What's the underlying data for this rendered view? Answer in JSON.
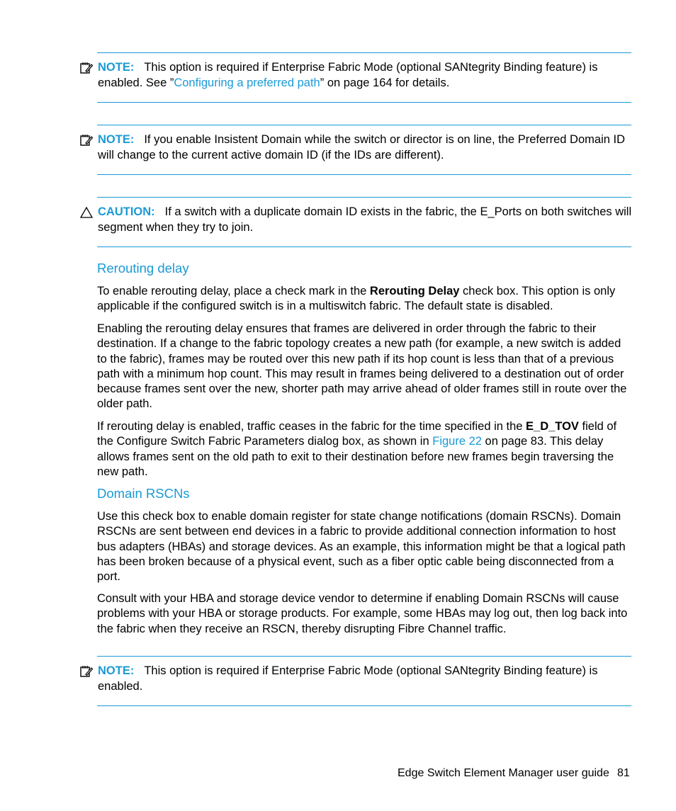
{
  "notes": [
    {
      "label": "NOTE:",
      "text_before": "This option is required if Enterprise Fabric Mode (optional SANtegrity Binding feature) is enabled. See ”",
      "link": "Configuring a preferred path",
      "text_after": "” on page 164 for details.",
      "icon": "note-icon"
    },
    {
      "label": "NOTE:",
      "text": "If you enable Insistent Domain while the switch or director is on line, the Preferred Domain ID will change to the current active domain ID (if the IDs are different).",
      "icon": "note-icon"
    }
  ],
  "caution": {
    "label": "CAUTION:",
    "text": "If a switch with a duplicate domain ID exists in the fabric, the E_Ports on both switches will segment when they try to join.",
    "icon": "caution-triangle-icon"
  },
  "sections": {
    "rerouting": {
      "heading": "Rerouting delay",
      "p1_before": "To enable rerouting delay, place a check mark in the ",
      "p1_bold": "Rerouting Delay",
      "p1_after": " check box. This option is only applicable if the configured switch is in a multiswitch fabric. The default state is disabled.",
      "p2": "Enabling the rerouting delay ensures that frames are delivered in order through the fabric to their destination. If a change to the fabric topology creates a new path (for example, a new switch is added to the fabric), frames may be routed over this new path if its hop count is less than that of a previous path with a minimum hop count. This may result in frames being delivered to a destination out of order because frames sent over the new, shorter path may arrive ahead of older frames still in route over the older path.",
      "p3_before": "If rerouting delay is enabled, traffic ceases in the fabric for the time specified in the ",
      "p3_bold": "E_D_TOV",
      "p3_mid": " field of the Configure Switch Fabric Parameters dialog box, as shown in ",
      "p3_link": "Figure 22",
      "p3_after": " on page 83. This delay allows frames sent on the old path to exit to their destination before new frames begin traversing the new path."
    },
    "rscn": {
      "heading": "Domain RSCNs",
      "p1": "Use this check box to enable domain register for state change notifications (domain RSCNs). Domain RSCNs are sent between end devices in a fabric to provide additional connection information to host bus adapters (HBAs) and storage devices. As an example, this information might be that a logical path has been broken because of a physical event, such as a fiber optic cable being disconnected from a port.",
      "p2": "Consult with your HBA and storage device vendor to determine if enabling Domain RSCNs will cause problems with your HBA or storage products. For example, some HBAs may log out, then log back into the fabric when they receive an RSCN, thereby disrupting Fibre Channel traffic."
    }
  },
  "final_note": {
    "label": "NOTE:",
    "text": "This option is required if Enterprise Fabric Mode (optional SANtegrity Binding feature) is enabled.",
    "icon": "note-icon"
  },
  "footer": {
    "title": "Edge Switch Element Manager user guide",
    "page_number": "81"
  },
  "colors": {
    "accent": "#1a9ad6",
    "text": "#000000"
  }
}
